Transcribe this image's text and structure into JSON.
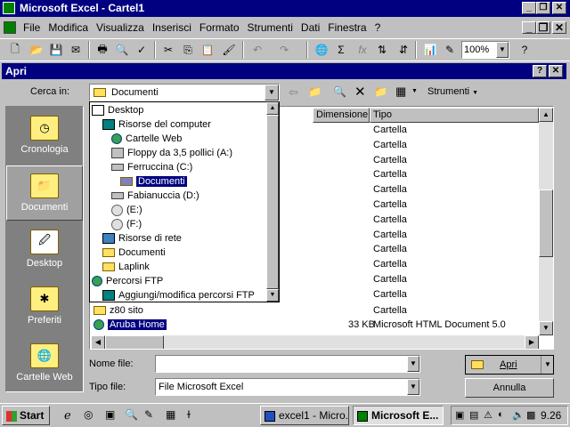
{
  "app": {
    "title": "Microsoft Excel - Cartel1",
    "menu": [
      "File",
      "Modifica",
      "Visualizza",
      "Inserisci",
      "Formato",
      "Strumenti",
      "Dati",
      "Finestra",
      "?"
    ],
    "zoom": "100%"
  },
  "dialog": {
    "title": "Apri",
    "look_in_label": "Cerca in:",
    "look_in_value": "Documenti",
    "tools_label": "Strumenti",
    "col_size": "Dimensione",
    "col_type": "Tipo",
    "places": [
      "Cronologia",
      "Documenti",
      "Desktop",
      "Preferiti",
      "Cartelle Web"
    ],
    "dropdown": [
      "Desktop",
      "Risorse del computer",
      "Cartelle Web",
      "Floppy da 3,5 pollici (A:)",
      "Ferruccina (C:)",
      "Documenti",
      "Fabianuccia (D:)",
      "(E:)",
      "(F:)",
      "Risorse di rete",
      "Documenti",
      "Laplink",
      "Percorsi FTP",
      "Aggiungi/modifica percorsi FTP"
    ],
    "type_column": [
      "Cartella",
      "Cartella",
      "Cartella",
      "Cartella",
      "Cartella",
      "Cartella",
      "Cartella",
      "Cartella",
      "Cartella",
      "Cartella",
      "Cartella",
      "Cartella"
    ],
    "list_rows": [
      {
        "name": "z80 sito",
        "size": "",
        "type": "Cartella"
      },
      {
        "name": "Aruba Home",
        "size": "33 KB",
        "type": "Microsoft HTML Document 5.0"
      }
    ],
    "filename_label": "Nome file:",
    "filename_value": "",
    "filetype_label": "Tipo file:",
    "filetype_value": "File Microsoft Excel",
    "open_button": "Apri",
    "cancel_button": "Annulla"
  },
  "taskbar": {
    "start": "Start",
    "tasks": [
      "excel1 - Micro...",
      "Microsoft E..."
    ],
    "clock": "9.26"
  }
}
